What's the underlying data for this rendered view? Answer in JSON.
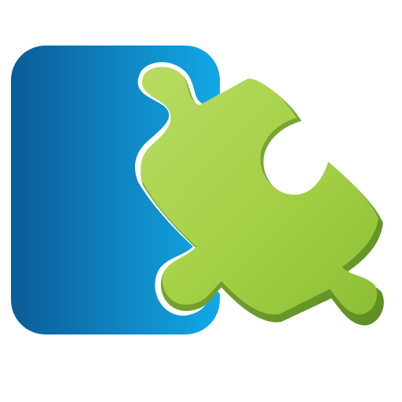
{
  "icon": {
    "name": "puzzle-piece-extension-icon",
    "colors": {
      "panel_light": "#12A9E6",
      "panel_dark": "#0B5C98",
      "piece_light": "#B8DC62",
      "piece_mid": "#9CCB3D",
      "piece_dark": "#6E9E2C",
      "outline": "#FFFFFF"
    }
  }
}
